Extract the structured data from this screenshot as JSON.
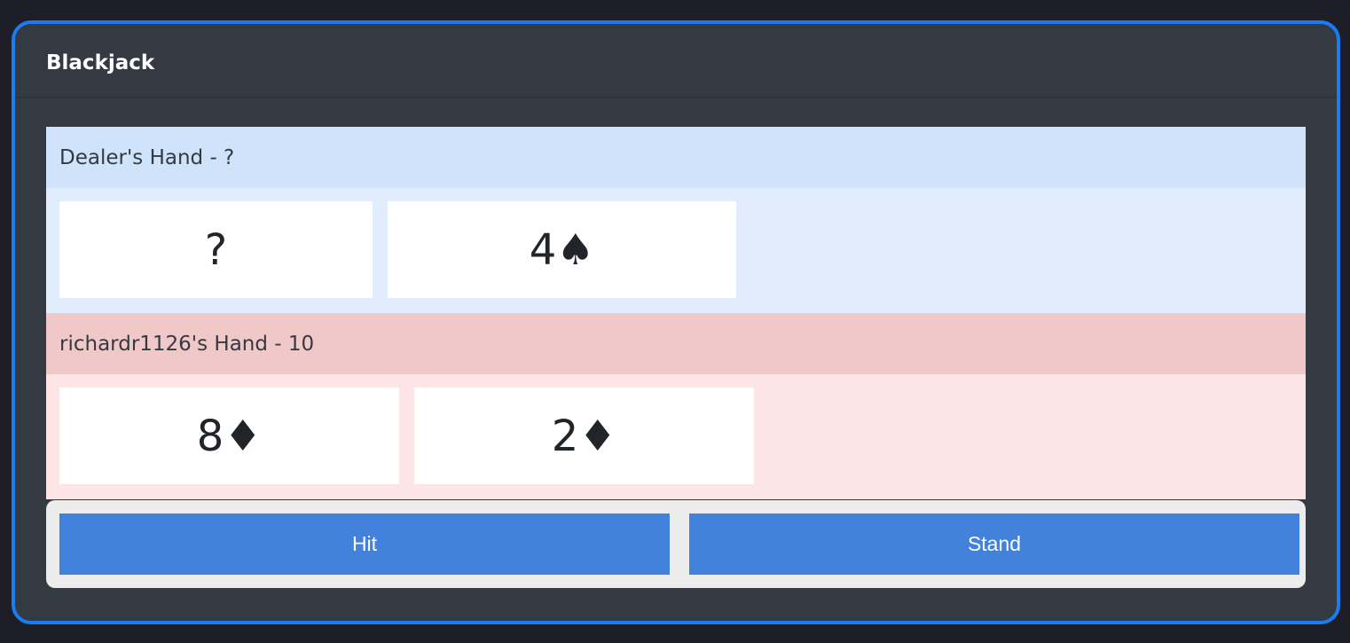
{
  "app": {
    "title": "Blackjack"
  },
  "dealer": {
    "header": "Dealer's Hand - ?",
    "cards": [
      "?",
      "4♠"
    ]
  },
  "player": {
    "header": "richardr1126's Hand - 10",
    "cards": [
      "8♦",
      "2♦"
    ]
  },
  "actions": {
    "hit_label": "Hit",
    "stand_label": "Stand"
  },
  "colors": {
    "accent_border": "#1a7cf0",
    "panel_bg": "#343a42",
    "dealer_header": "#cfe3fb",
    "dealer_body": "#e1edfc",
    "player_header": "#f1c8c8",
    "player_body": "#fde5e5",
    "button": "#4282dc"
  }
}
